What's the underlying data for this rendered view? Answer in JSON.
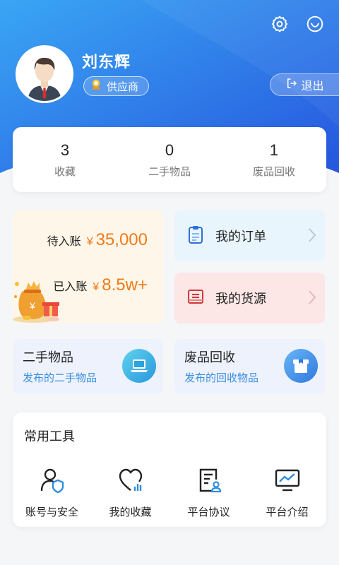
{
  "profile": {
    "name": "刘东辉",
    "role": "供应商",
    "logout_label": "退出"
  },
  "stats": [
    {
      "value": "3",
      "label": "收藏"
    },
    {
      "value": "0",
      "label": "二手物品"
    },
    {
      "value": "1",
      "label": "废品回收"
    }
  ],
  "account": {
    "pending_label": "待入账",
    "pending_currency": "¥",
    "pending_value": "35,000",
    "received_label": "已入账",
    "received_currency": "¥",
    "received_value": "8.5w+"
  },
  "nav": {
    "orders_label": "我的订单",
    "supply_label": "我的货源"
  },
  "publish": [
    {
      "title": "二手物品",
      "subtitle": "发布的二手物品"
    },
    {
      "title": "废品回收",
      "subtitle": "发布的回收物品"
    }
  ],
  "tools": {
    "title": "常用工具",
    "items": [
      {
        "label": "账号与安全",
        "icon": "account-security-icon"
      },
      {
        "label": "我的收藏",
        "icon": "favorites-icon"
      },
      {
        "label": "平台协议",
        "icon": "agreement-icon"
      },
      {
        "label": "平台介绍",
        "icon": "intro-icon"
      }
    ]
  },
  "colors": {
    "header_start": "#3aa0f2",
    "header_end": "#2a5fe0",
    "accent_orange": "#f07b1a",
    "link_blue": "#3a8fe0"
  }
}
